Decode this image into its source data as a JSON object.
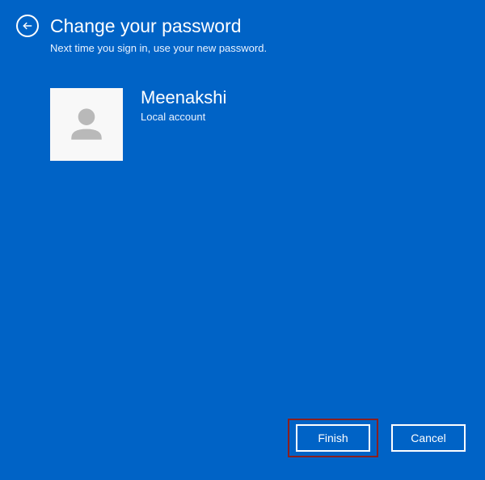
{
  "header": {
    "title": "Change your password",
    "subtitle": "Next time you sign in, use your new password."
  },
  "user": {
    "name": "Meenakshi",
    "account_type": "Local account"
  },
  "buttons": {
    "finish": "Finish",
    "cancel": "Cancel"
  }
}
